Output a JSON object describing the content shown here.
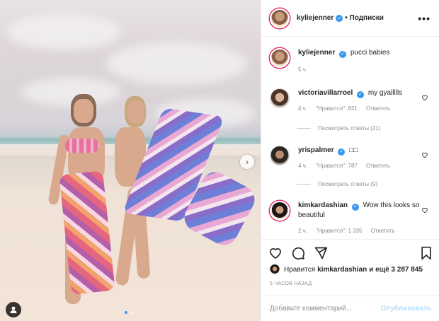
{
  "post": {
    "author": "kyliejenner",
    "follow_label": "• Подписки",
    "more_label": "•••"
  },
  "caption": {
    "username": "kyliejenner",
    "text": "pucci babies",
    "time": "5 ч."
  },
  "comments": [
    {
      "username": "victoriavillarroel",
      "text": "my gyallllls",
      "time": "4 ч.",
      "likes": "\"Нравится\": 821",
      "reply_label": "Ответить",
      "view_replies": "Посмотреть ответы (21)"
    },
    {
      "username": "yrispalmer",
      "text": "□□",
      "time": "4 ч.",
      "likes": "\"Нравится\": 787",
      "reply_label": "Ответить",
      "view_replies": "Посмотреть ответы (9)"
    },
    {
      "username": "kimkardashian",
      "text": "Wow this looks so beautiful",
      "time": "2 ч.",
      "likes": "\"Нравится\": 1 335",
      "reply_label": "Ответить"
    }
  ],
  "likes_line": {
    "prefix": "Нравится",
    "user": "kimkardashian",
    "suffix": "и ещё 3 287 845"
  },
  "timestamp": "5 ЧАСОВ НАЗАД",
  "comment_box": {
    "placeholder": "Добавьте комментарий...",
    "publish_label": "Опубликовать"
  },
  "icons": {
    "verified": "verified-badge-icon",
    "heart": "heart-icon",
    "comment": "comment-icon",
    "share": "share-icon",
    "bookmark": "bookmark-icon",
    "next": "chevron-right-icon",
    "tag": "user-tag-icon"
  },
  "colors": {
    "accent": "#3897f0",
    "publish_disabled": "#b2dffc",
    "muted": "#8e8e8e"
  },
  "carousel": {
    "current": 1,
    "total": 2
  }
}
